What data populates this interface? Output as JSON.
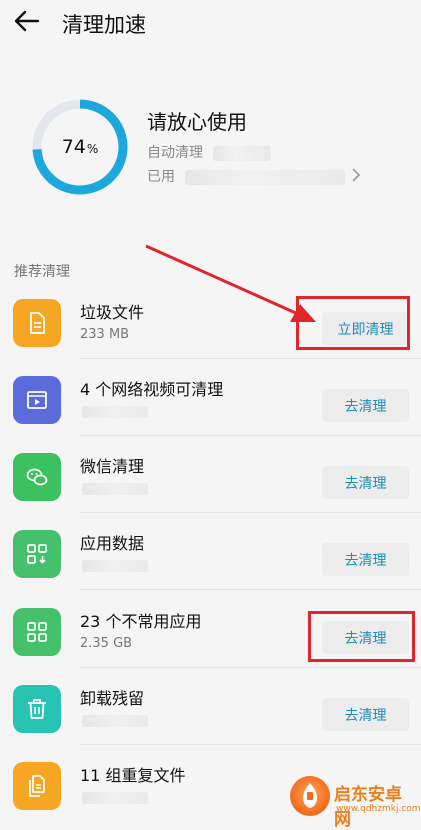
{
  "header": {
    "title": "清理加速"
  },
  "status": {
    "percent": "74",
    "percent_unit": "%",
    "title": "请放心使用",
    "auto_clean_label": "自动清理",
    "used_label": "已用"
  },
  "section_title": "推荐清理",
  "items": [
    {
      "name": "垃圾文件",
      "sub": "233 MB",
      "button": "立即清理",
      "icon": "document-icon",
      "color": "#f6a623"
    },
    {
      "name": "4 个网络视频可清理",
      "sub": "",
      "button": "去清理",
      "icon": "video-icon",
      "color": "#5b6bdc"
    },
    {
      "name": "微信清理",
      "sub": "",
      "button": "去清理",
      "icon": "wechat-icon",
      "color": "#3cc160"
    },
    {
      "name": "应用数据",
      "sub": "",
      "button": "去清理",
      "icon": "app-data-icon",
      "color": "#44c16a"
    },
    {
      "name": "23 个不常用应用",
      "sub": "2.35 GB",
      "button": "去清理",
      "icon": "app-grid-icon",
      "color": "#44c16a"
    },
    {
      "name": "卸载残留",
      "sub": "",
      "button": "去清理",
      "icon": "trash-icon",
      "color": "#27c4b4"
    },
    {
      "name": "11 组重复文件",
      "sub": "",
      "button": "",
      "icon": "duplicate-files-icon",
      "color": "#f6a623"
    }
  ],
  "ring_progress": 0.74,
  "colors": {
    "accent": "#1ca8dc",
    "ring_track": "#e3e6ea",
    "highlight": "#e0262a"
  },
  "watermark": {
    "text": "启东安卓网",
    "url": "www.qdhzmkj.com"
  }
}
